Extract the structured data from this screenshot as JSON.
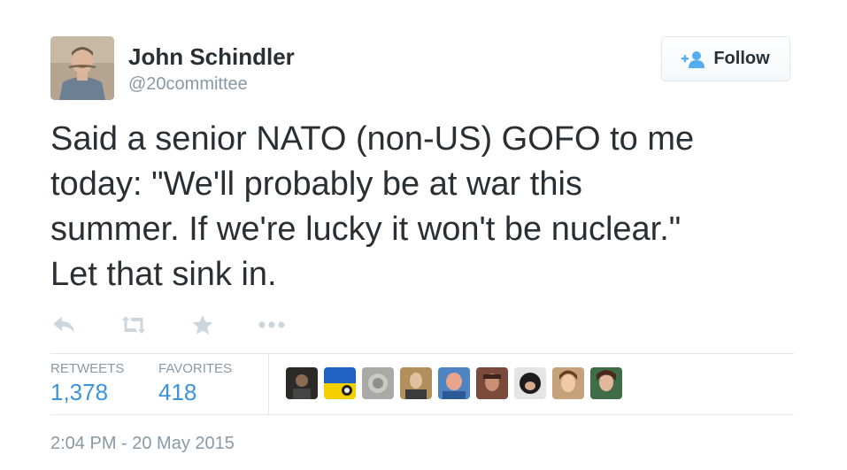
{
  "author": {
    "name": "John Schindler",
    "handle": "@20committee"
  },
  "follow_button": {
    "label": "Follow",
    "icon": "add-user-icon"
  },
  "tweet": {
    "lines": [
      "Said a senior NATO (non-US) GOFO to me",
      "today: \"We'll probably be at war this",
      "summer. If we're lucky it won't be nuclear.\"",
      "Let that sink in."
    ]
  },
  "actions": [
    {
      "name": "reply",
      "icon": "reply-icon"
    },
    {
      "name": "retweet",
      "icon": "retweet-icon"
    },
    {
      "name": "favorite",
      "icon": "star-icon"
    },
    {
      "name": "more",
      "icon": "more-icon"
    }
  ],
  "stats": {
    "retweets_label": "RETWEETS",
    "retweets_count": "1,378",
    "favorites_label": "FAVORITES",
    "favorites_count": "418"
  },
  "timestamp": "2:04 PM - 20 May 2015",
  "colors": {
    "text": "#292f33",
    "muted": "#8899a6",
    "accent": "#3b94d9",
    "icon": "#ccd6dd",
    "border": "#e1e8ed"
  }
}
